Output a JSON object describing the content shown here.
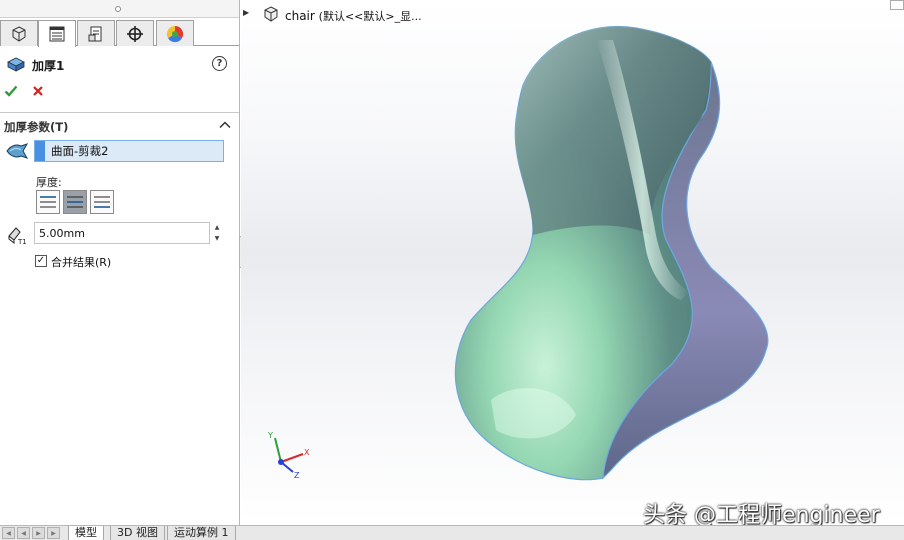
{
  "panel": {
    "tabs": [
      "feature-manager",
      "property-manager",
      "configuration-manager",
      "dimxpert-manager",
      "display-manager"
    ],
    "title": "加厚1",
    "help": "?",
    "section_title": "加厚参数(T)",
    "face_selection": "曲面-剪裁2",
    "thickness_label": "厚度:",
    "thickness_value": "5.00mm",
    "merge_label": "合并结果(R)",
    "merge_checked": true,
    "thickness_side_selected": 1
  },
  "viewport": {
    "tree_part": "chair",
    "tree_config": "(默认<<默认>_显...",
    "triad_axes": [
      "Y",
      "X",
      "Z"
    ],
    "watermark": "头条 @工程师engineer",
    "accent": "#4a90e2"
  },
  "bottom_tabs": {
    "items": [
      "模型",
      "3D 视图",
      "运动算例 1"
    ],
    "active": 0
  }
}
